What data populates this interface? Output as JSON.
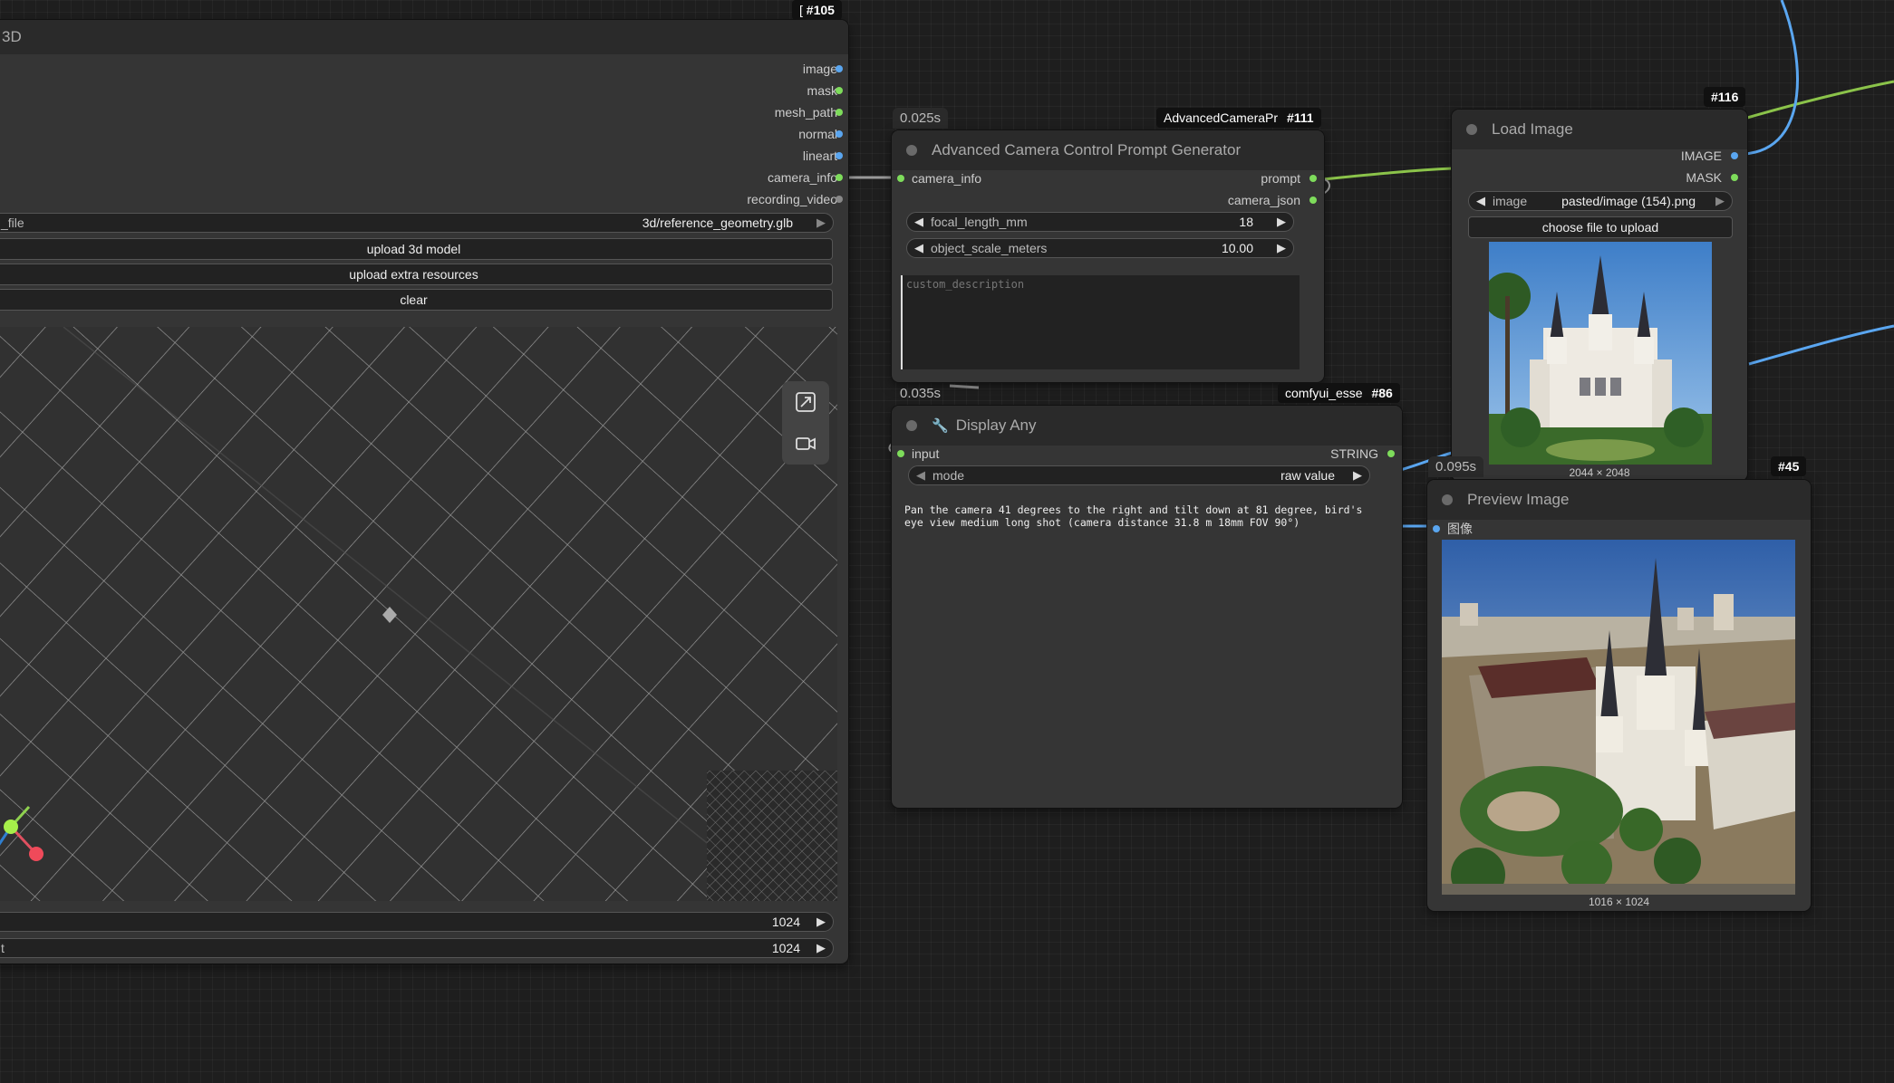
{
  "node_3d": {
    "title": "3D",
    "badge_id": "#105",
    "badge_prefix": "[",
    "outputs": [
      "image",
      "mask",
      "mesh_path",
      "normal",
      "lineart",
      "camera_info",
      "recording_video"
    ],
    "model_file_label": "_file",
    "model_file_value": "3d/reference_geometry.glb",
    "upload_model_label": "upload 3d model",
    "upload_extra_label": "upload extra resources",
    "clear_label": "clear",
    "width_label": "",
    "width_value": "1024",
    "height_label": "t",
    "height_value": "1024"
  },
  "node_camera": {
    "timing": "0.025s",
    "badge_name": "AdvancedCameraPr",
    "badge_id": "#111",
    "title": "Advanced Camera Control Prompt Generator",
    "input": "camera_info",
    "outputs": [
      "prompt",
      "camera_json"
    ],
    "focal_label": "focal_length_mm",
    "focal_value": "18",
    "scale_label": "object_scale_meters",
    "scale_value": "10.00",
    "description_placeholder": "custom_description"
  },
  "node_display": {
    "timing": "0.035s",
    "badge_name": "comfyui_esse",
    "badge_id": "#86",
    "title": "Display Any",
    "input": "input",
    "output": "STRING",
    "mode_label": "mode",
    "mode_value": "raw value",
    "text": "Pan the camera 41 degrees to the right and tilt down at 81 degree, bird's eye view medium long shot (camera distance 31.8 m 18mm FOV 90°)"
  },
  "node_load": {
    "badge_id": "#116",
    "title": "Load Image",
    "outputs": [
      "IMAGE",
      "MASK"
    ],
    "image_label": "image",
    "image_value": "pasted/image (154).png",
    "upload_label": "choose file to upload",
    "dimensions": "2044 × 2048"
  },
  "node_preview": {
    "timing": "0.095s",
    "badge_id": "#45",
    "title": "Preview Image",
    "input": "图像",
    "dimensions": "1016 × 1024"
  },
  "colors": {
    "canvas": "#1e1e1e",
    "node_body": "#353535",
    "node_title": "#2a2a2a",
    "wire_green": "#8bc34a",
    "wire_blue": "#5aa6f0",
    "slot_green": "#7edc5b"
  }
}
